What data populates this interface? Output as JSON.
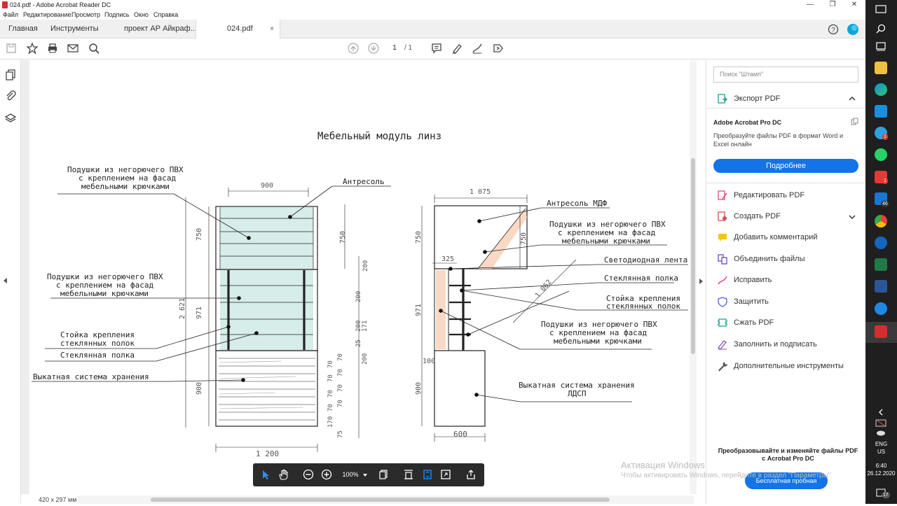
{
  "window": {
    "title": "024.pdf - Adobe Acrobat Reader DC",
    "minimize": "—",
    "maximize": "❐",
    "close": "✕"
  },
  "menu": [
    "Файл",
    "Редактирование",
    "Просмотр",
    "Подпись",
    "Окно",
    "Справка"
  ],
  "tabs": {
    "home": "Главная",
    "tools": "Инструменты",
    "doc1": "проект АР Айкраф...",
    "doc2": "024.pdf",
    "close": "×"
  },
  "toolbar": {
    "page_current": "1",
    "page_total": "/ 1"
  },
  "drawing": {
    "title": "Мебельный модуль линз",
    "left": {
      "dim_top": "900",
      "dim_750": "750",
      "dim_750b": "750",
      "dim_2621": "2 621",
      "dim_971": "971",
      "dim_900": "900",
      "dim_1200": "1 200",
      "dim_200a": "200",
      "dim_200b": "200",
      "dim_200c": "200",
      "dim_171": "171",
      "dim_25": "25",
      "dim_200d": "200",
      "dim_70": [
        "70",
        "70",
        "70",
        "70",
        "70",
        "70",
        "70",
        "70"
      ],
      "dim_170": "170",
      "dim_75": "75",
      "label_antresol": "Антресоль",
      "label_pillow1": [
        "Подушки из негорючего ПВХ",
        "с креплением на фасад",
        "мебельными крючками"
      ],
      "label_pillow2": [
        "Подушки из негорючего ПВХ",
        "с креплением на фасад",
        "мебельными крючками"
      ],
      "label_stand": [
        "Стойка крепления",
        "стеклянных полок"
      ],
      "label_shelf": "Стеклянная полка",
      "label_storage": "Выкатная система хранения"
    },
    "right": {
      "dim_1075": "1 075",
      "dim_750": "750",
      "dim_750b": "750",
      "dim_325": "325",
      "dim_971": "971",
      "dim_1062": "1 062",
      "dim_100": "100",
      "dim_900": "900",
      "dim_600": "600",
      "label_mdf": "Антресоль МДФ",
      "label_pillow1": [
        "Подушки из негорючего ПВХ",
        "с креплением на фасад",
        "мебельными крючками"
      ],
      "label_led": "Светодиодная лента",
      "label_shelf": "Стеклянная полка",
      "label_stand": [
        "Стойка крепления",
        "стеклянных полок"
      ],
      "label_pillow2": [
        "Подушки из негорючего ПВХ",
        "с креплением на фасад",
        "мебельными крючками"
      ],
      "label_storage": [
        "Выкатная система хранения",
        "ЛДСП"
      ]
    }
  },
  "status": {
    "page_size": "420 x 297 мм"
  },
  "zoombar": {
    "zoom": "100%"
  },
  "right_panel": {
    "search_placeholder": "Поиск \"Штамп\"",
    "export_pdf": "Экспорт PDF",
    "promo_title": "Adobe Acrobat Pro DC",
    "promo_text": "Преобразуйте файлы PDF в формат Word и Excel онлайн",
    "promo_button": "Подробнее",
    "tools": [
      "Редактировать PDF",
      "Создать PDF",
      "Добавить комментарий",
      "Объединить файлы",
      "Исправить",
      "Защитить",
      "Сжать PDF",
      "Заполнить и подписать",
      "Дополнительные инструменты"
    ],
    "footer_text": "Преобразовывайте и изменяйте файлы PDF с Acrobat Pro DC",
    "trial_button": "Бесплатная пробная версия"
  },
  "watermark": {
    "line1": "Активация Windows",
    "line2": "Чтобы активировать Windows, перейдите в раздел \"Параметры\"."
  },
  "taskbar": {
    "badge_telegram": "1",
    "badge_unknown": "1",
    "badge_46": "46",
    "lang1": "ENG",
    "lang2": "US",
    "time": "6:40",
    "date": "26.12.2020",
    "notif": "17"
  },
  "colors": {
    "accent": "#1473e6",
    "pillow_fill": "#d6ede9",
    "insulation_fill": "#f9d9c5",
    "acrobat_red": "#d32f2f"
  }
}
